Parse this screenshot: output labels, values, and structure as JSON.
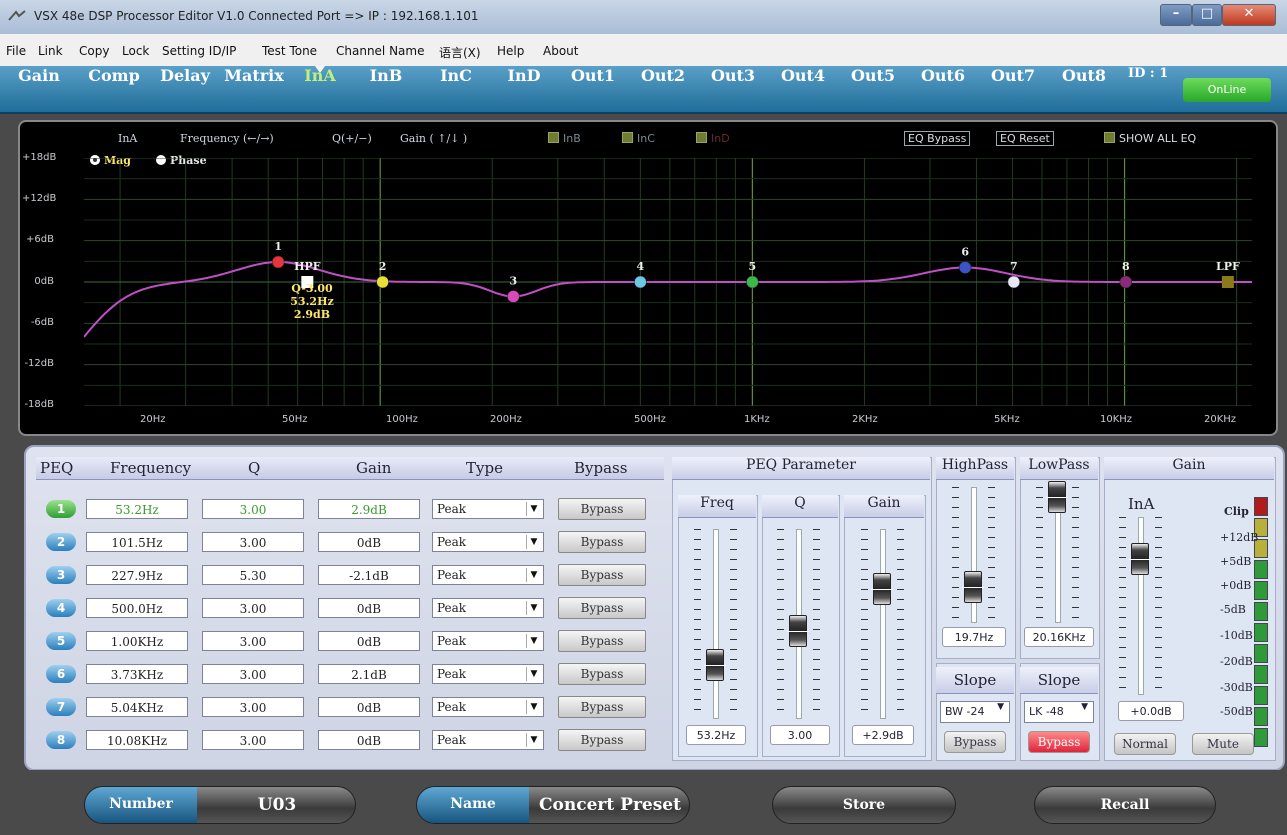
{
  "window": {
    "title": "VSX 48e DSP Processor Editor V1.0    Connected Port => IP : 192.168.1.101"
  },
  "menu": [
    "File",
    "Link",
    "Copy",
    "Lock",
    "Setting ID/IP",
    "Test Tone",
    "Channel Name",
    "语言(X)",
    "Help",
    "About"
  ],
  "tabs": [
    "Gain",
    "Comp",
    "Delay",
    "Matrix",
    "InA",
    "InB",
    "InC",
    "InD",
    "Out1",
    "Out2",
    "Out3",
    "Out4",
    "Out5",
    "Out6",
    "Out7",
    "Out8"
  ],
  "active_tab": "InA",
  "device_id": "ID : 1",
  "online_label": "OnLine",
  "graph": {
    "channel": "InA",
    "freq_hint": "Frequency (←/→)",
    "q_hint": "Q(+/−)",
    "gain_hint": "Gain ( ↑/↓ )",
    "link_channels": [
      "InB",
      "InC",
      "InD"
    ],
    "eq_bypass": "EQ Bypass",
    "eq_reset": "EQ Reset",
    "show_all_eq": "SHOW ALL EQ",
    "radio_mag": "Mag",
    "radio_phase": "Phase",
    "hpf_label": "HPF",
    "lpf_label": "LPF",
    "tooltip": [
      "Q-3.00",
      "53.2Hz",
      "2.9dB"
    ],
    "y_ticks": [
      "+18dB",
      "+12dB",
      "+6dB",
      "0dB",
      "-6dB",
      "-12dB",
      "-18dB"
    ],
    "x_ticks": [
      "20Hz",
      "50Hz",
      "100Hz",
      "200Hz",
      "500Hz",
      "1KHz",
      "2KHz",
      "5KHz",
      "10KHz",
      "20KHz"
    ]
  },
  "chart_data": {
    "type": "line",
    "x_scale": "log",
    "xlim_hz": [
      16,
      22000
    ],
    "ylim_db": [
      -18,
      18
    ],
    "grid": true,
    "points": [
      {
        "label": "1",
        "freq_hz": 53.2,
        "gain_db": 2.9,
        "color": "#e8343c"
      },
      {
        "label": "2",
        "freq_hz": 101.5,
        "gain_db": 0,
        "color": "#e8e034"
      },
      {
        "label": "3",
        "freq_hz": 227.9,
        "gain_db": -2.1,
        "color": "#d84ab8"
      },
      {
        "label": "4",
        "freq_hz": 500,
        "gain_db": 0,
        "color": "#6cc8e4"
      },
      {
        "label": "5",
        "freq_hz": 1000,
        "gain_db": 0,
        "color": "#3cb84a"
      },
      {
        "label": "6",
        "freq_hz": 3730,
        "gain_db": 2.1,
        "color": "#3c52c8"
      },
      {
        "label": "7",
        "freq_hz": 5040,
        "gain_db": 0,
        "color": "#e8e8f4"
      },
      {
        "label": "8",
        "freq_hz": 10080,
        "gain_db": 0,
        "color": "#8a2a7a"
      }
    ],
    "hpf_hz": 19.7,
    "lpf_hz": 20160,
    "curve_color": "#c24fc8"
  },
  "peq": {
    "headers": [
      "PEQ",
      "Frequency",
      "Q",
      "Gain",
      "Type",
      "Bypass"
    ],
    "rows": [
      {
        "n": "1",
        "freq": "53.2Hz",
        "q": "3.00",
        "gain": "2.9dB",
        "type": "Peak",
        "bypass": "Bypass"
      },
      {
        "n": "2",
        "freq": "101.5Hz",
        "q": "3.00",
        "gain": "0dB",
        "type": "Peak",
        "bypass": "Bypass"
      },
      {
        "n": "3",
        "freq": "227.9Hz",
        "q": "5.30",
        "gain": "-2.1dB",
        "type": "Peak",
        "bypass": "Bypass"
      },
      {
        "n": "4",
        "freq": "500.0Hz",
        "q": "3.00",
        "gain": "0dB",
        "type": "Peak",
        "bypass": "Bypass"
      },
      {
        "n": "5",
        "freq": "1.00KHz",
        "q": "3.00",
        "gain": "0dB",
        "type": "Peak",
        "bypass": "Bypass"
      },
      {
        "n": "6",
        "freq": "3.73KHz",
        "q": "3.00",
        "gain": "2.1dB",
        "type": "Peak",
        "bypass": "Bypass"
      },
      {
        "n": "7",
        "freq": "5.04KHz",
        "q": "3.00",
        "gain": "0dB",
        "type": "Peak",
        "bypass": "Bypass"
      },
      {
        "n": "8",
        "freq": "10.08KHz",
        "q": "3.00",
        "gain": "0dB",
        "type": "Peak",
        "bypass": "Bypass"
      }
    ]
  },
  "peq_param": {
    "title": "PEQ Parameter",
    "freq": {
      "label": "Freq",
      "value": "53.2Hz"
    },
    "q": {
      "label": "Q",
      "value": "3.00"
    },
    "gain": {
      "label": "Gain",
      "value": "+2.9dB"
    }
  },
  "highpass": {
    "title": "HighPass",
    "value": "19.7Hz",
    "slope_label": "Slope",
    "slope": "BW -24",
    "bypass": "Bypass"
  },
  "lowpass": {
    "title": "LowPass",
    "value": "20.16KHz",
    "slope_label": "Slope",
    "slope": "LK -48",
    "bypass": "Bypass"
  },
  "gain_panel": {
    "title": "Gain",
    "channel": "InA",
    "value": "+0.0dB",
    "normal": "Normal",
    "mute": "Mute",
    "meter_labels": [
      "Clip",
      "+12dB",
      "+5dB",
      "+0dB",
      "-5dB",
      "-10dB",
      "-20dB",
      "-30dB",
      "-50dB"
    ]
  },
  "footer": {
    "number_label": "Number",
    "number_value": "U03",
    "name_label": "Name",
    "name_value": "Concert Preset",
    "store": "Store",
    "recall": "Recall"
  }
}
